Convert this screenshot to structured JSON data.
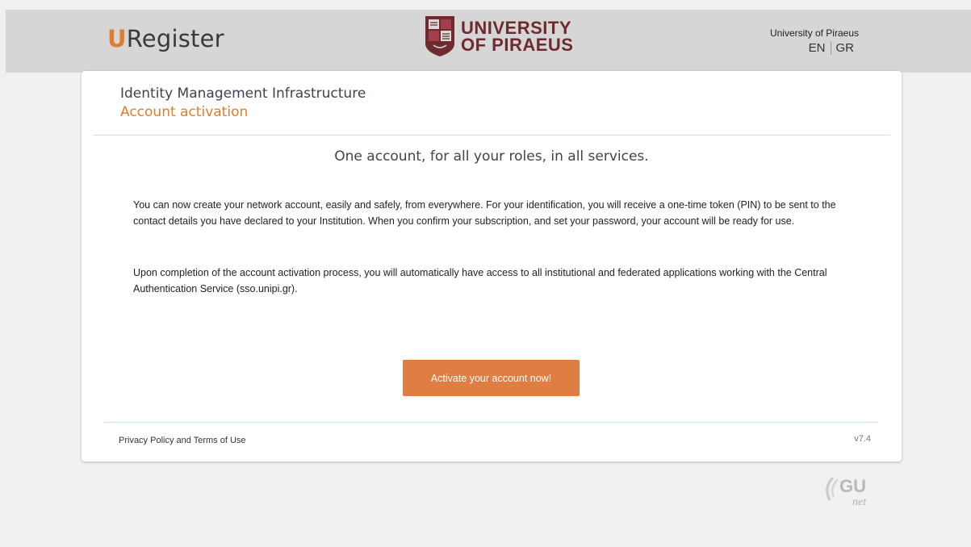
{
  "header": {
    "brand_initial": "U",
    "brand_rest": "Register",
    "university_line1": "UNIVERSITY",
    "university_line2": "OF PIRAEUS",
    "institution": "University of Piraeus",
    "languages": [
      "EN",
      "GR"
    ]
  },
  "card": {
    "title": "Identity Management Infrastructure",
    "subtitle": "Account activation",
    "tagline": "One account, for all your roles, in all services.",
    "paragraphs": [
      "You can now create your network account, easily and safely, from everywhere. For your identification, you will receive a one-time token (PIN) to be sent to the contact details you have declared to your Institution. When you confirm your subscription, and set your password, your account will be ready for use.",
      "Upon completion of the account activation process, you will automatically have access to all institutional and federated applications working with the Central Authentication Service (sso.unipi.gr)."
    ],
    "activate_label": "Activate your account now!"
  },
  "footer": {
    "privacy_label": "Privacy Policy and Terms of Use",
    "version": "v7.4"
  },
  "gunet_logo": {
    "text_main": "GU",
    "text_sub": "net"
  },
  "colors": {
    "accent": "#e07d2c",
    "button": "#e07d42",
    "topbar": "#d6d6d6",
    "university": "#6e2a2f"
  }
}
